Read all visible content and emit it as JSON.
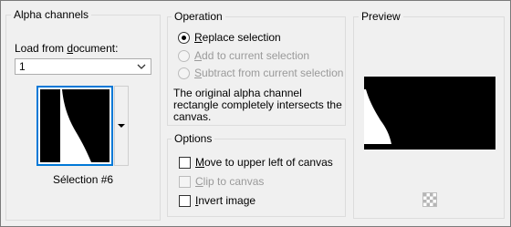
{
  "alpha_channels": {
    "title": "Alpha channels",
    "load_label": "Load from document:",
    "document_value": "1",
    "selection_name": "Sélection #6",
    "dropdown_icon": "triangle-down-icon"
  },
  "operation": {
    "title": "Operation",
    "options": [
      {
        "label": "Replace selection",
        "selected": true,
        "enabled": true
      },
      {
        "label": "Add to current selection",
        "selected": false,
        "enabled": false
      },
      {
        "label": "Subtract from current selection",
        "selected": false,
        "enabled": false
      }
    ],
    "description": [
      "The original alpha channel",
      "rectangle completely intersects the",
      "canvas."
    ]
  },
  "options": {
    "title": "Options",
    "checkboxes": [
      {
        "label": "Move to upper left of canvas",
        "checked": false,
        "enabled": true
      },
      {
        "label": "Clip to canvas",
        "checked": false,
        "enabled": false
      },
      {
        "label": "Invert image",
        "checked": false,
        "enabled": true
      }
    ]
  },
  "preview": {
    "title": "Preview",
    "toggle_icon": "checkerboard-icon"
  },
  "colors": {
    "selection_border": "#0078d7",
    "dialog_bg": "#f0f0f0"
  }
}
